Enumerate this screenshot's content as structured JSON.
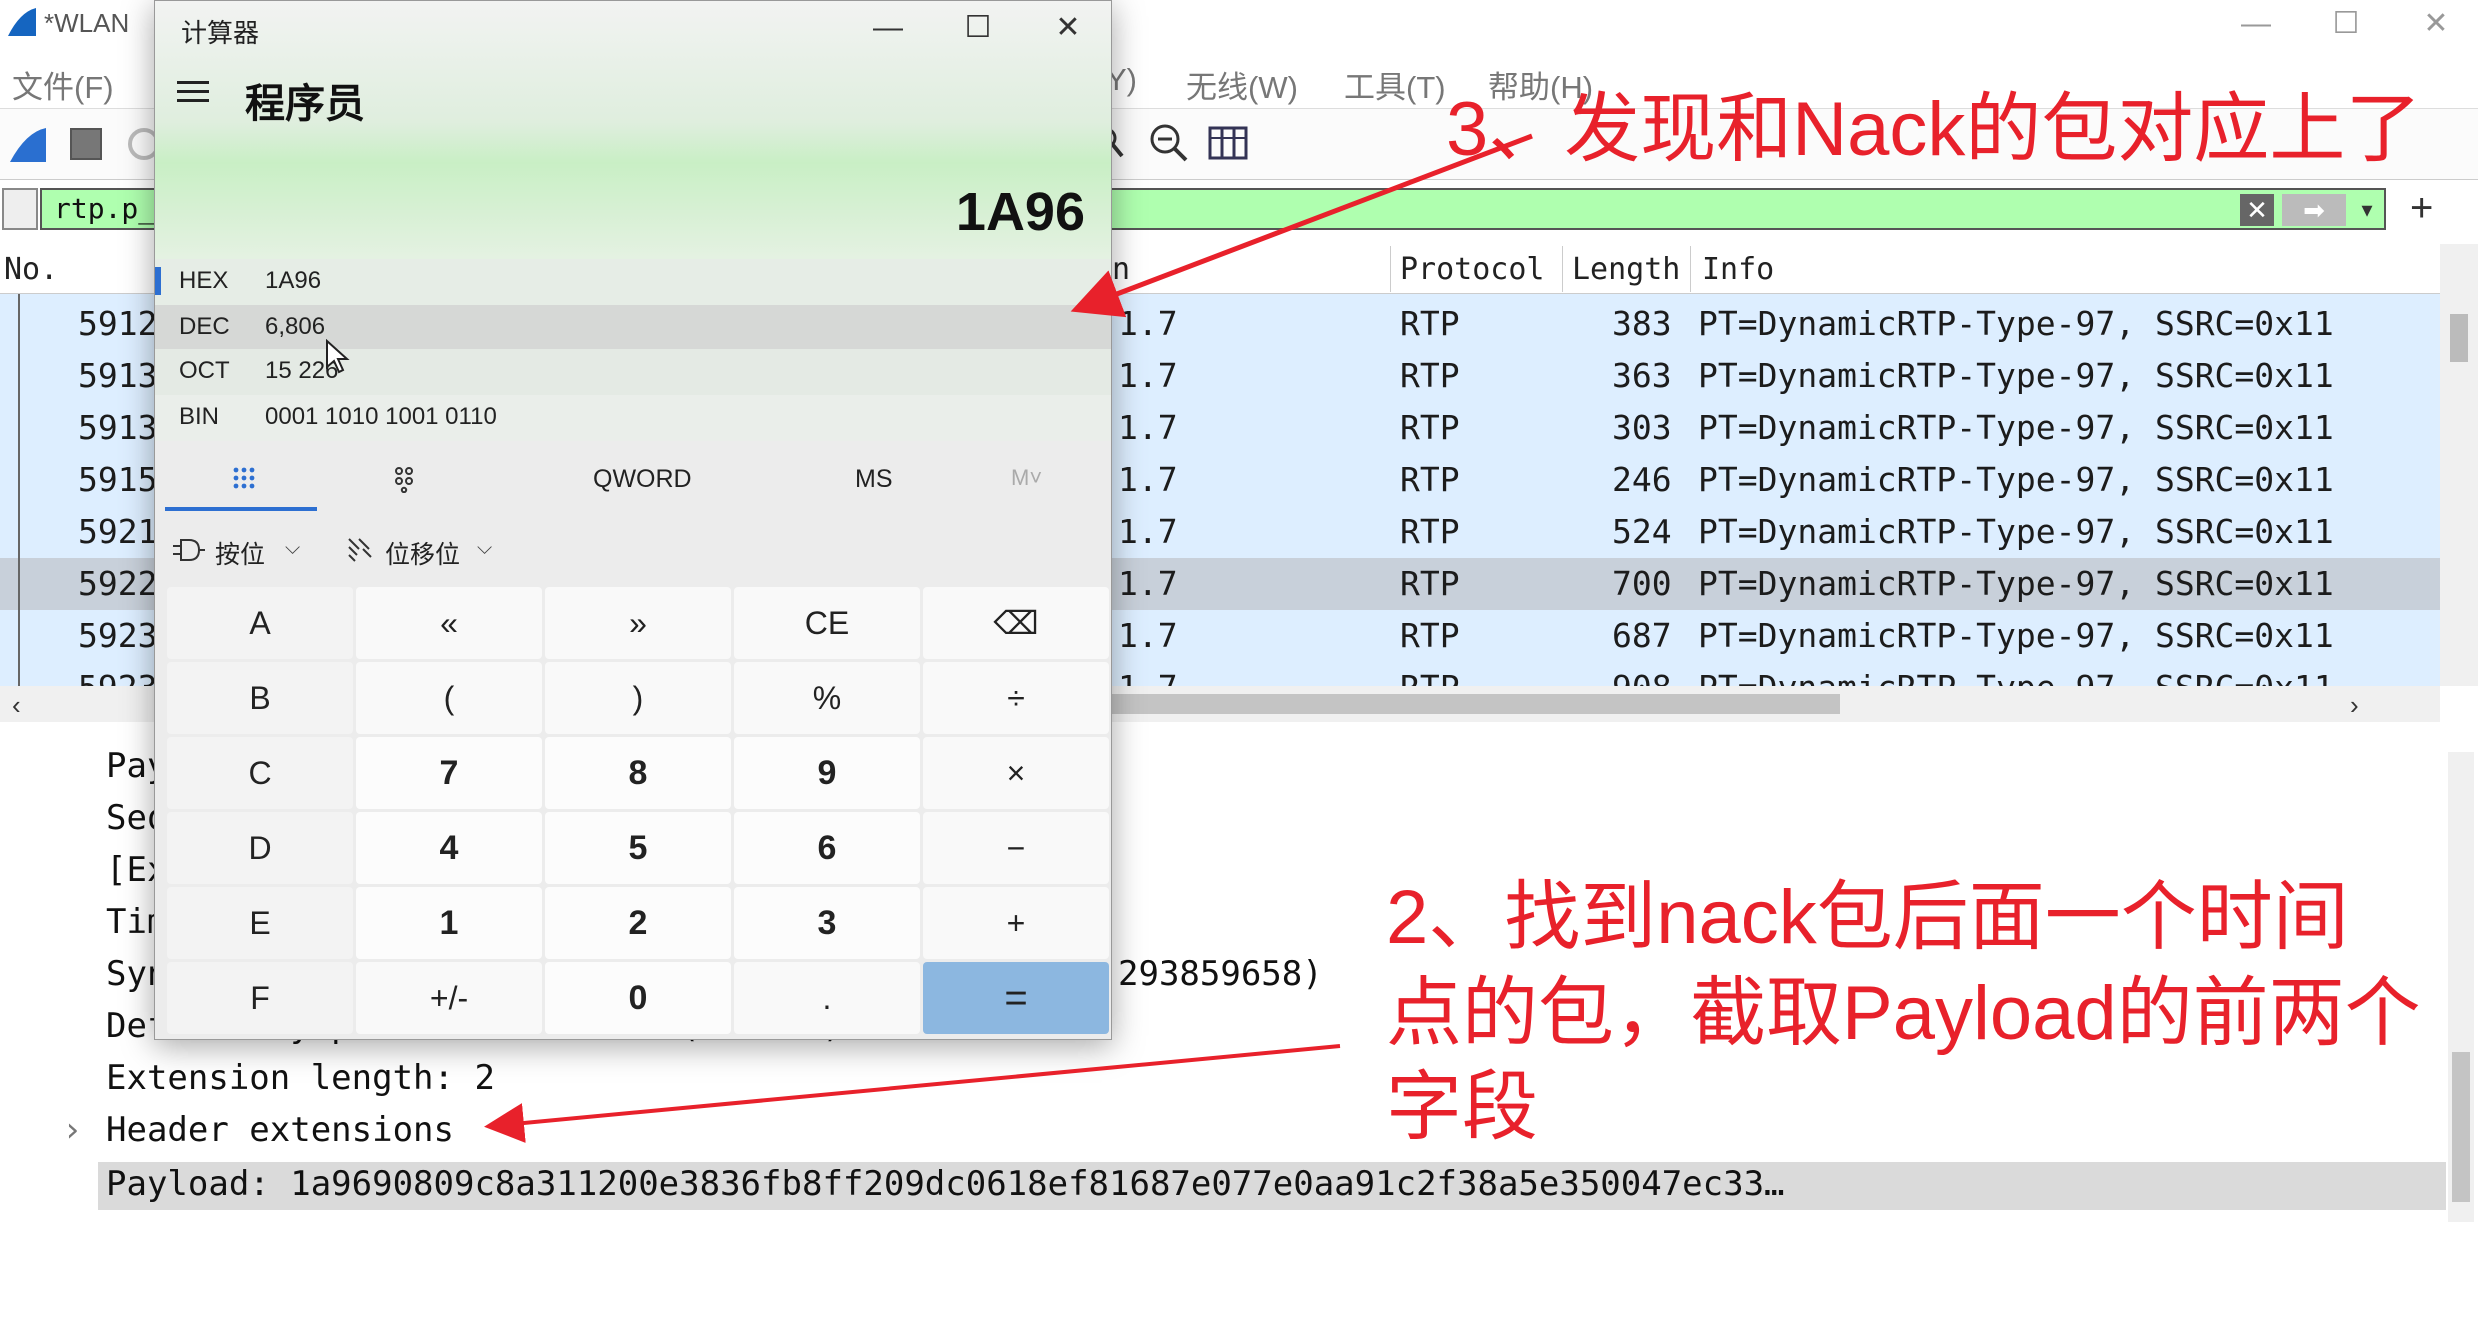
{
  "wireshark": {
    "title": "*WLAN",
    "menu": [
      "文件(F)",
      "Y)",
      "无线(W)",
      "工具(T)",
      "帮助(H)"
    ],
    "filter_value": "rtp.p_t",
    "plus_label": "+",
    "columns": {
      "no": "No.",
      "dst_tail": "n",
      "protocol": "Protocol",
      "length": "Length",
      "info": "Info"
    },
    "rows": [
      {
        "no": "5912",
        "dst": "1.7",
        "protocol": "RTP",
        "length": "383",
        "info": "PT=DynamicRTP-Type-97, SSRC=0x11"
      },
      {
        "no": "5913",
        "dst": "1.7",
        "protocol": "RTP",
        "length": "363",
        "info": "PT=DynamicRTP-Type-97, SSRC=0x11"
      },
      {
        "no": "5913",
        "dst": "1.7",
        "protocol": "RTP",
        "length": "303",
        "info": "PT=DynamicRTP-Type-97, SSRC=0x11"
      },
      {
        "no": "5915",
        "dst": "1.7",
        "protocol": "RTP",
        "length": "246",
        "info": "PT=DynamicRTP-Type-97, SSRC=0x11"
      },
      {
        "no": "5921",
        "dst": "1.7",
        "protocol": "RTP",
        "length": "524",
        "info": "PT=DynamicRTP-Type-97, SSRC=0x11"
      },
      {
        "no": "5922",
        "dst": "1.7",
        "protocol": "RTP",
        "length": "700",
        "info": "PT=DynamicRTP-Type-97, SSRC=0x11"
      },
      {
        "no": "5923",
        "dst": "1.7",
        "protocol": "RTP",
        "length": "687",
        "info": "PT=DynamicRTP-Type-97, SSRC=0x11"
      },
      {
        "no": "5923",
        "dst": "1.7",
        "protocol": "RTP",
        "length": "908",
        "info": "PT=DynamicRTP-Type-97, SSRC=0x11"
      }
    ],
    "selected_row": 5,
    "detail": {
      "l1": "Pay",
      "l2": "Seq",
      "l3": "[Ex",
      "l4": "Tim",
      "l5": "Syn",
      "l5_tail": "293859658)",
      "l6": "Defined by profile: Unknown (0xbede)",
      "l7": "Extension length: 2",
      "l8": "Header extensions",
      "l8_arrow": "›",
      "l9": "Payload: 1a9690809c8a311200e3836fb8ff209dc0618ef81687e077e0aa91c2f38a5e350047ec33…"
    }
  },
  "calculator": {
    "title": "计算器",
    "mode": "程序员",
    "display": "1A96",
    "radix": [
      {
        "name": "HEX",
        "value": "1A96"
      },
      {
        "name": "DEC",
        "value": "6,806"
      },
      {
        "name": "OCT",
        "value": "15 226"
      },
      {
        "name": "BIN",
        "value": "0001 1010 1001 0110"
      }
    ],
    "tabs": {
      "qword": "QWORD",
      "ms": "MS",
      "m": "M˅"
    },
    "bitwise": "按位",
    "bitshift": "位移位",
    "keys": [
      [
        "A",
        "«",
        "»",
        "CE",
        "⌫"
      ],
      [
        "B",
        "(",
        ")",
        "%",
        "÷"
      ],
      [
        "C",
        "7",
        "8",
        "9",
        "×"
      ],
      [
        "D",
        "4",
        "5",
        "6",
        "−"
      ],
      [
        "E",
        "1",
        "2",
        "3",
        "+"
      ],
      [
        "F",
        "+/-",
        "0",
        ".",
        "="
      ]
    ]
  },
  "annotations": {
    "a3": "3、发现和Nack的包对应上了",
    "a2_line1": "2、找到nack包后面一个时间",
    "a2_line2": "点的包，截取Payload的前两个",
    "a2_line3": "字段"
  },
  "colors": {
    "annotation": "#e8212b",
    "filter_bg": "#afffaf",
    "row_bg": "#ddeeff",
    "selected_row_bg": "#c8d0da",
    "equals_key": "#8cb7e0"
  }
}
